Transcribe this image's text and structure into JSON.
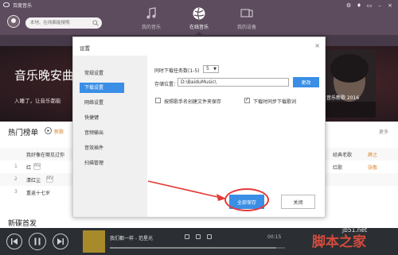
{
  "app": {
    "title": "百度音乐"
  },
  "search": {
    "placeholder": "本地、在线都能搜哦"
  },
  "window": {
    "controls": [
      "gear-icon",
      "skin-icon",
      "mini-icon",
      "minimize-icon",
      "close-icon"
    ]
  },
  "nav": [
    {
      "label": "我的音乐",
      "icon": "music-note-icon",
      "active": false
    },
    {
      "label": "在线音乐",
      "icon": "globe-icon",
      "active": true
    },
    {
      "label": "我的设备",
      "icon": "device-icon",
      "active": false
    }
  ],
  "banner": {
    "title": "音乐晚安曲",
    "subtitle": "入睡了，让音乐都能",
    "caption": "音乐新歌 2016"
  },
  "ranking": {
    "title": "热门榜单",
    "new_label": "新歌",
    "more_label": "更多",
    "rows": [
      {
        "num": "",
        "title": "我好像在哪见过你",
        "tag": "",
        "album": "经典老歌",
        "artist": "薛之"
      },
      {
        "num": "1",
        "title": "红",
        "tag": "MV",
        "album": "红歌",
        "artist": "张敬"
      },
      {
        "num": "2",
        "title": "清红尘",
        "tag": "MV",
        "album": "",
        "artist": ""
      },
      {
        "num": "3",
        "title": "重返十七岁",
        "tag": "",
        "album": "",
        "artist": ""
      }
    ]
  },
  "new_releases": {
    "title": "新碟首发"
  },
  "player": {
    "now_playing": "我们都一样 - 范星光",
    "time": "00:15",
    "progress": 0.95
  },
  "watermark": {
    "main": "脚本之家",
    "site": "jb51.net"
  },
  "dialog": {
    "title": "设置",
    "close_glyph": "×",
    "sidebar": [
      {
        "label": "常规设置",
        "active": false
      },
      {
        "label": "下载设置",
        "active": true
      },
      {
        "label": "网络设置",
        "active": false
      },
      {
        "label": "快捷键",
        "active": false
      },
      {
        "label": "音频输出",
        "active": false
      },
      {
        "label": "音效插件",
        "active": false
      },
      {
        "label": "扫描管理",
        "active": false
      }
    ],
    "concurrent_label": "同时下载任务数(1-5)",
    "concurrent_value": "5",
    "path_label": "存储位置：",
    "path_value": "D:\\BaiduMusic\\",
    "change_label": "更改",
    "opt_by_singer": "按照歌手名创建文件夹保存",
    "opt_by_singer_checked": false,
    "opt_lyrics": "下载时同步下载歌词",
    "opt_lyrics_checked": true,
    "save_all_label": "全部保存",
    "close_label": "关闭"
  }
}
